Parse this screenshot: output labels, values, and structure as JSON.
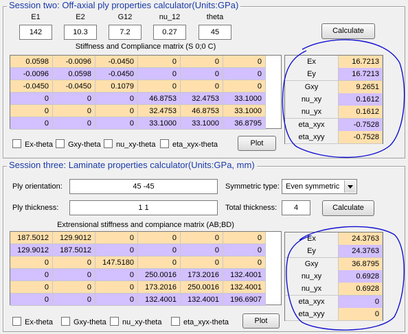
{
  "session2": {
    "title": "Session two: Off-axial ply properties calculator(Units:GPa)",
    "inputs": [
      {
        "label": "E1",
        "value": "142"
      },
      {
        "label": "E2",
        "value": "10.3"
      },
      {
        "label": "G12",
        "value": "7.2"
      },
      {
        "label": "nu_12",
        "value": "0.27"
      },
      {
        "label": "theta",
        "value": "45"
      }
    ],
    "calculate_label": "Calculate",
    "matrix_title": "Stiffness and Compliance matrix (S 0;0 C)",
    "matrix": [
      [
        "0.0598",
        "-0.0096",
        "-0.0450",
        "0",
        "0",
        "0"
      ],
      [
        "-0.0096",
        "0.0598",
        "-0.0450",
        "0",
        "0",
        "0"
      ],
      [
        "-0.0450",
        "-0.0450",
        "0.1079",
        "0",
        "0",
        "0"
      ],
      [
        "0",
        "0",
        "0",
        "46.8753",
        "32.4753",
        "33.1000"
      ],
      [
        "0",
        "0",
        "0",
        "32.4753",
        "46.8753",
        "33.1000"
      ],
      [
        "0",
        "0",
        "0",
        "33.1000",
        "33.1000",
        "36.8795"
      ]
    ],
    "properties": [
      {
        "name": "Ex",
        "value": "16.7213"
      },
      {
        "name": "Ey",
        "value": "16.7213"
      },
      {
        "name": "Gxy",
        "value": "9.2651"
      },
      {
        "name": "nu_xy",
        "value": "0.1612"
      },
      {
        "name": "nu_yx",
        "value": "0.1612"
      },
      {
        "name": "eta_xyx",
        "value": "-0.7528"
      },
      {
        "name": "eta_xyy",
        "value": "-0.7528"
      }
    ],
    "checkboxes": [
      "Ex-theta",
      "Gxy-theta",
      "nu_xy-theta",
      "eta_xyx-theta"
    ],
    "plot_label": "Plot"
  },
  "session3": {
    "title": "Session three: Laminate properties calculator(Units:GPa, mm)",
    "ply_orientation_label": "Ply orientation:",
    "ply_orientation_value": "45 -45",
    "symmetric_type_label": "Symmetric type:",
    "symmetric_type_value": "Even symmetric",
    "ply_thickness_label": "Ply thickness:",
    "ply_thickness_value": "1 1",
    "total_thickness_label": "Total thickness:",
    "total_thickness_value": "4",
    "calculate_label": "Calculate",
    "matrix_title": "Extrensional stiffness and compiance matrix (AB;BD)",
    "matrix": [
      [
        "187.5012",
        "129.9012",
        "0",
        "0",
        "0",
        "0"
      ],
      [
        "129.9012",
        "187.5012",
        "0",
        "0",
        "0",
        "0"
      ],
      [
        "0",
        "0",
        "147.5180",
        "0",
        "0",
        "0"
      ],
      [
        "0",
        "0",
        "0",
        "250.0016",
        "173.2016",
        "132.4001"
      ],
      [
        "0",
        "0",
        "0",
        "173.2016",
        "250.0016",
        "132.4001"
      ],
      [
        "0",
        "0",
        "0",
        "132.4001",
        "132.4001",
        "196.6907"
      ]
    ],
    "properties": [
      {
        "name": "Ex",
        "value": "24.3763"
      },
      {
        "name": "Ey",
        "value": "24.3763"
      },
      {
        "name": "Gxy",
        "value": "36.8795"
      },
      {
        "name": "nu_xy",
        "value": "0.6928"
      },
      {
        "name": "nu_yx",
        "value": "0.6928"
      },
      {
        "name": "eta_xyx",
        "value": "0"
      },
      {
        "name": "eta_xyy",
        "value": "0"
      }
    ],
    "checkboxes": [
      "Ex-theta",
      "Gxy-theta",
      "nu_xy-theta",
      "eta_xyx-theta"
    ],
    "plot_label": "Plot"
  },
  "colors": {
    "title_blue": "#1a3aa8",
    "row_orange": "#ffe0ac",
    "row_purple": "#d2c0ff",
    "annotation_ink": "#1010d0"
  }
}
